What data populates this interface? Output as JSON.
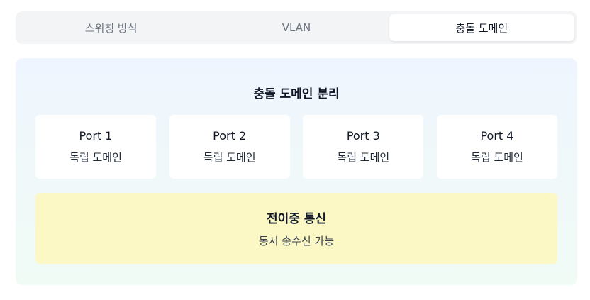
{
  "tabs": [
    {
      "label": "스위칭 방식",
      "active": false
    },
    {
      "label": "VLAN",
      "active": false
    },
    {
      "label": "충돌 도메인",
      "active": true
    }
  ],
  "panel": {
    "title": "충돌 도메인 분리",
    "ports": [
      {
        "name": "Port 1",
        "domain": "독립 도메인"
      },
      {
        "name": "Port 2",
        "domain": "독립 도메인"
      },
      {
        "name": "Port 3",
        "domain": "독립 도메인"
      },
      {
        "name": "Port 4",
        "domain": "독립 도메인"
      }
    ],
    "duplex": {
      "title": "전이중 통신",
      "description": "동시 송수신 가능"
    }
  },
  "colors": {
    "tabbar_bg": "#f3f4f6",
    "active_tab_bg": "#ffffff",
    "panel_gradient_top": "#eff5fe",
    "panel_gradient_bottom": "#f0fbf5",
    "duplex_bg": "#fbf8c6"
  }
}
